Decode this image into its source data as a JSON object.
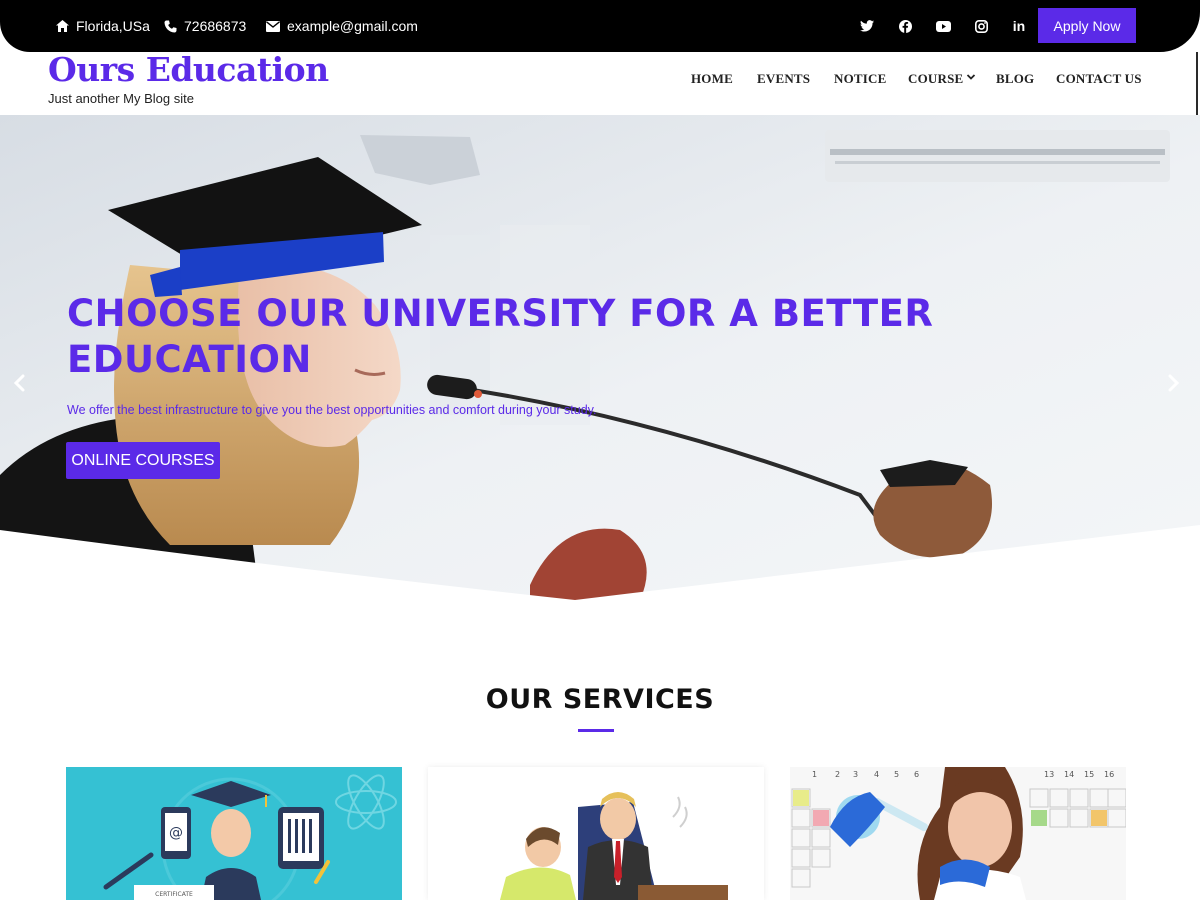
{
  "topbar": {
    "location": "Florida,USa",
    "phone": "72686873",
    "email": "example@gmail.com",
    "social_icons": [
      "twitter-icon",
      "facebook-icon",
      "youtube-icon",
      "instagram-icon",
      "linkedin-icon"
    ],
    "apply_label": "Apply Now"
  },
  "brand": {
    "title": "Ours Education",
    "tagline": "Just another My Blog site"
  },
  "nav": {
    "items": [
      {
        "label": "HOME"
      },
      {
        "label": "EVENTS"
      },
      {
        "label": "NOTICE"
      },
      {
        "label": "COURSE"
      },
      {
        "label": "BLOG"
      },
      {
        "label": "CONTACT US"
      }
    ]
  },
  "hero": {
    "title": "CHOOSE OUR UNIVERSITY FOR A BETTER EDUCATION",
    "subtitle": "We offer the best infrastructure to give you the best opportunities and comfort during your study.",
    "button_label": "ONLINE COURSES"
  },
  "services": {
    "title": "OUR SERVICES"
  },
  "colors": {
    "accent": "#5b2ae8",
    "topbar_bg": "#000000"
  }
}
